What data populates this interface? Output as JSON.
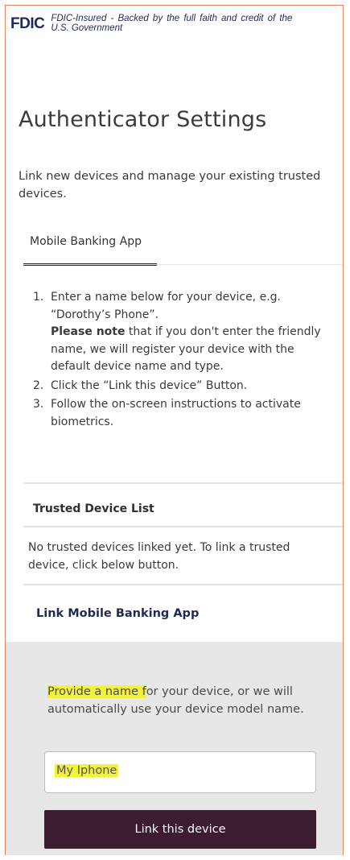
{
  "header": {
    "logo_text": "FDIC",
    "tagline": "FDIC-Insured - Backed by the full faith and credit of the U.S. Government"
  },
  "page": {
    "title": "Authenticator Settings",
    "subtitle": "Link new devices and manage your existing trusted devices."
  },
  "tabs": [
    {
      "label": "Mobile Banking App",
      "active": true
    }
  ],
  "instructions": [
    {
      "num": "1.",
      "text_a": "Enter a name below for your device, e.g. “Dorothy’s Phone”.",
      "bold": "Please note",
      "text_b": " that if you don't enter the friendly name, we will register your device with the default device name and type."
    },
    {
      "num": "2.",
      "text": "Click the “Link this device” Button."
    },
    {
      "num": "3.",
      "text": "Follow the on-screen instructions to activate biometrics."
    }
  ],
  "trusted": {
    "heading": "Trusted Device List",
    "empty_message": "No trusted devices linked yet. To link a trusted device, click below button."
  },
  "link_section": {
    "heading": "Link Mobile Banking App",
    "prompt_highlight": "Provide a name f",
    "prompt_rest": "or your device, or we will automatically use your device model name.",
    "device_name_value": "My Iphone",
    "button_label": "Link this device"
  },
  "colors": {
    "brand_dark": "#3b1d2f",
    "highlight": "#f2f23a",
    "fdic_blue": "#1d2a5c",
    "frame_border": "#e8825a"
  }
}
